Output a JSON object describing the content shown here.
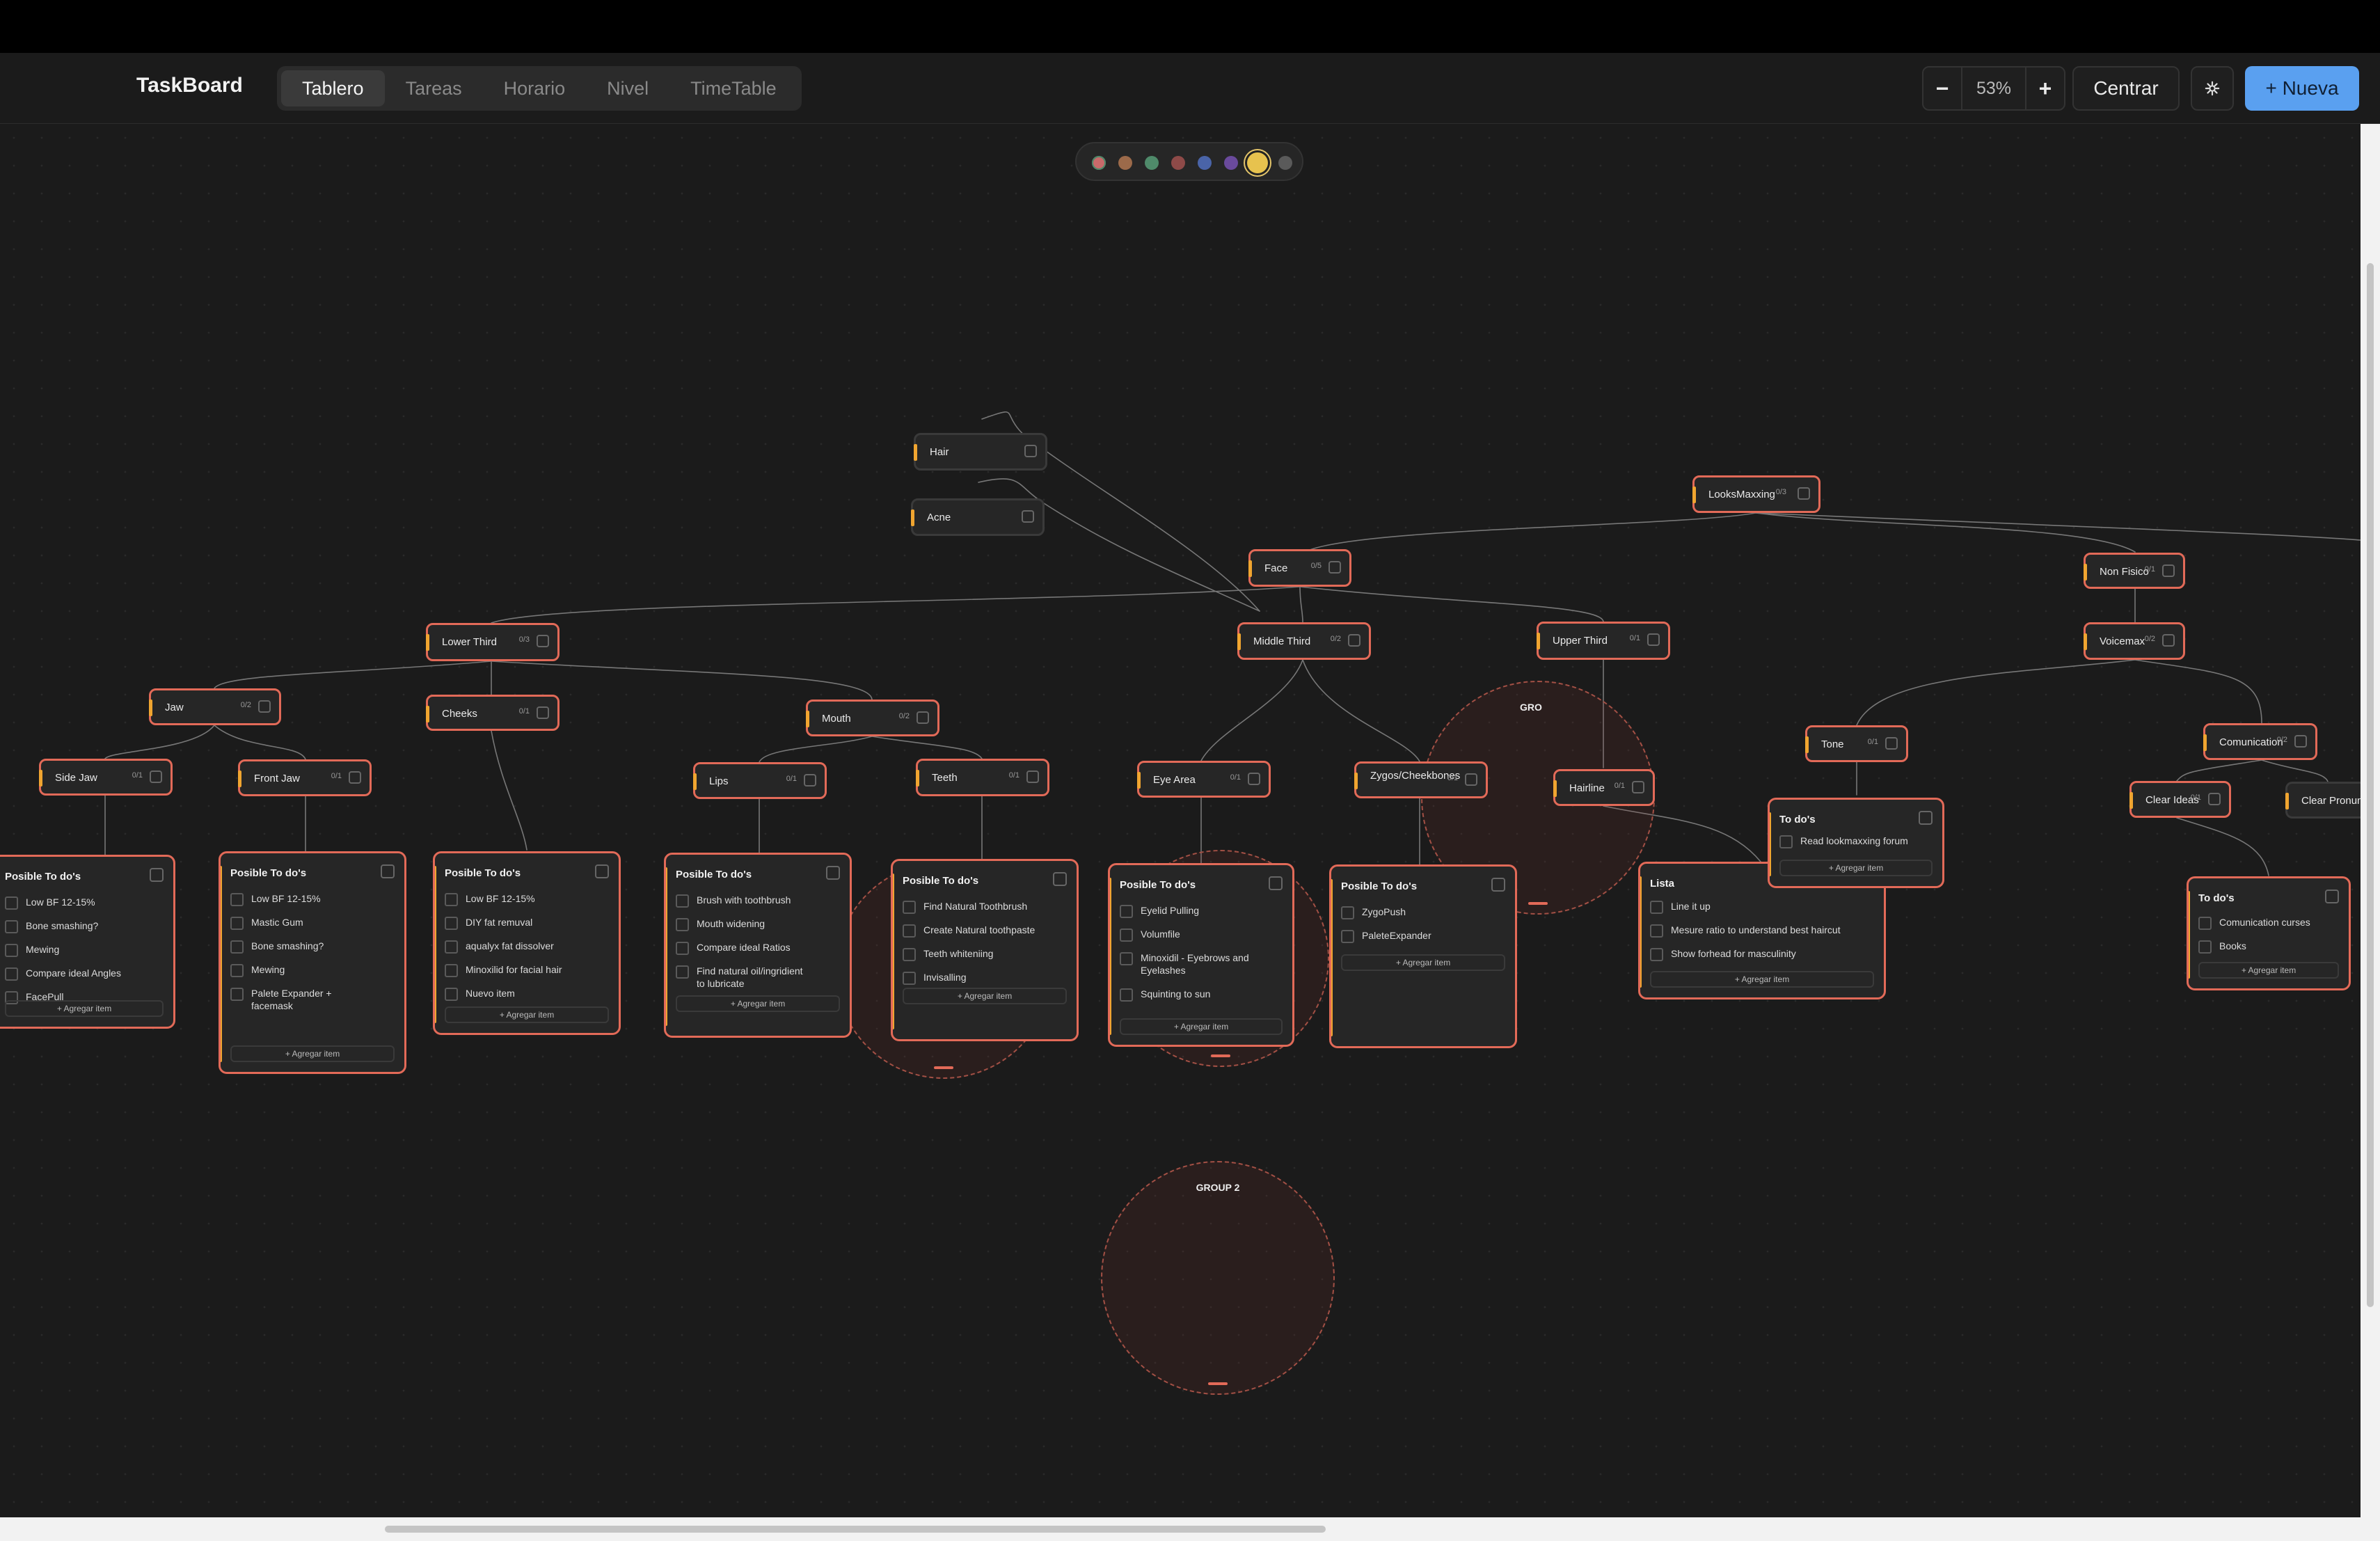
{
  "app": {
    "brand": "TaskBoard"
  },
  "tabs": [
    {
      "label": "Tablero",
      "active": true
    },
    {
      "label": "Tareas",
      "active": false
    },
    {
      "label": "Horario",
      "active": false
    },
    {
      "label": "Nivel",
      "active": false
    },
    {
      "label": "TimeTable",
      "active": false
    }
  ],
  "toolbar": {
    "zoom_out": "−",
    "zoom_level": "53%",
    "zoom_in": "+",
    "center_label": "Centrar",
    "settings_icon": "gear-icon",
    "new_label": "+ Nueva"
  },
  "palette": {
    "colors": [
      "#c86a6a",
      "#9c6a4a",
      "#4f8a6a",
      "#8e4a48",
      "#4a64a8",
      "#6a4a9c",
      "#e7c24e",
      "#5a5a5a"
    ],
    "selected": 6
  },
  "theme": {
    "accent": "#e26a58",
    "marker": "#f0a530",
    "new_button": "#5aa0f0"
  },
  "nodes": [
    {
      "id": "hair",
      "label": "Hair",
      "count": ""
    },
    {
      "id": "acne",
      "label": "Acne",
      "count": ""
    },
    {
      "id": "looksmaxxing",
      "label": "LooksMaxxing",
      "count": "0/3"
    },
    {
      "id": "face",
      "label": "Face",
      "count": "0/5"
    },
    {
      "id": "nonfisico",
      "label": "Non Fisico",
      "count": "0/1"
    },
    {
      "id": "lowerthird",
      "label": "Lower Third",
      "count": "0/3"
    },
    {
      "id": "middlethird",
      "label": "Middle Third",
      "count": "0/2"
    },
    {
      "id": "upperthird",
      "label": "Upper Third",
      "count": "0/1"
    },
    {
      "id": "voicemax",
      "label": "Voicemax",
      "count": "0/2"
    },
    {
      "id": "jaw",
      "label": "Jaw",
      "count": "0/2"
    },
    {
      "id": "cheeks",
      "label": "Cheeks",
      "count": "0/1"
    },
    {
      "id": "mouth",
      "label": "Mouth",
      "count": "0/2"
    },
    {
      "id": "sidejaw",
      "label": "Side Jaw",
      "count": "0/1"
    },
    {
      "id": "frontjaw",
      "label": "Front Jaw",
      "count": "0/1"
    },
    {
      "id": "lips",
      "label": "Lips",
      "count": "0/1"
    },
    {
      "id": "teeth",
      "label": "Teeth",
      "count": "0/1"
    },
    {
      "id": "eyearea",
      "label": "Eye Area",
      "count": "0/1"
    },
    {
      "id": "zygos",
      "label": "Zygos/Cheekbones",
      "count": "0/1"
    },
    {
      "id": "hairline",
      "label": "Hairline",
      "count": "0/1"
    },
    {
      "id": "tone",
      "label": "Tone",
      "count": "0/1"
    },
    {
      "id": "comunication",
      "label": "Comunication",
      "count": "0/2"
    },
    {
      "id": "clearideas",
      "label": "Clear Ideas",
      "count": "0/1"
    },
    {
      "id": "clearpronun",
      "label": "Clear Pronun",
      "count": ""
    }
  ],
  "cards": [
    {
      "id": "c-sidejaw",
      "title": "Posible To do's",
      "add_label": "+ Agregar item",
      "items": [
        "Low BF 12-15%",
        "Bone smashing?",
        "Mewing",
        "Compare ideal Angles",
        "FacePull"
      ]
    },
    {
      "id": "c-frontjaw",
      "title": "Posible To do's",
      "add_label": "+ Agregar item",
      "items": [
        "Low BF 12-15%",
        "Mastic Gum",
        "Bone smashing?",
        "Mewing",
        "Palete Expander + facemask"
      ]
    },
    {
      "id": "c-cheeks",
      "title": "Posible To do's",
      "add_label": "+ Agregar item",
      "items": [
        "Low BF 12-15%",
        "DIY fat remuval",
        "aqualyx fat dissolver",
        "Minoxilid for facial hair",
        "Nuevo item"
      ]
    },
    {
      "id": "c-lips",
      "title": "Posible To do's",
      "add_label": "+ Agregar item",
      "items": [
        "Brush with toothbrush",
        "Mouth widening",
        "Compare ideal Ratios",
        "Find natural oil/ingridient to lubricate"
      ]
    },
    {
      "id": "c-teeth",
      "title": "Posible To do's",
      "add_label": "+ Agregar item",
      "items": [
        "Find Natural Toothbrush",
        "Create Natural toothpaste",
        "Teeth whiteniing",
        "Invisalling"
      ]
    },
    {
      "id": "c-eyearea",
      "title": "Posible To do's",
      "add_label": "+ Agregar item",
      "items": [
        "Eyelid Pulling",
        "Volumfile",
        "Minoxidil - Eyebrows and Eyelashes",
        "Squinting to sun"
      ]
    },
    {
      "id": "c-zygos",
      "title": "Posible To do's",
      "add_label": "+ Agregar item",
      "items": [
        "ZygoPush",
        "PaleteExpander"
      ]
    },
    {
      "id": "c-lista",
      "title": "Lista",
      "add_label": "+ Agregar item",
      "items": [
        "Line it up",
        "Mesure ratio to understand best haircut",
        "Show forhead for masculinity"
      ]
    },
    {
      "id": "c-tone",
      "title": "To do's",
      "add_label": "+ Agregar item",
      "items": [
        "Read lookmaxxing forum"
      ]
    },
    {
      "id": "c-clearideas",
      "title": "To do's",
      "add_label": "+ Agregar item",
      "items": [
        "Comunication curses",
        "Books"
      ]
    }
  ],
  "groups": [
    {
      "id": "g-upper",
      "title": "GRO"
    },
    {
      "id": "g-teeth",
      "title": ""
    },
    {
      "id": "g-eye",
      "title": ""
    },
    {
      "id": "g-2",
      "title": "GROUP 2"
    }
  ]
}
